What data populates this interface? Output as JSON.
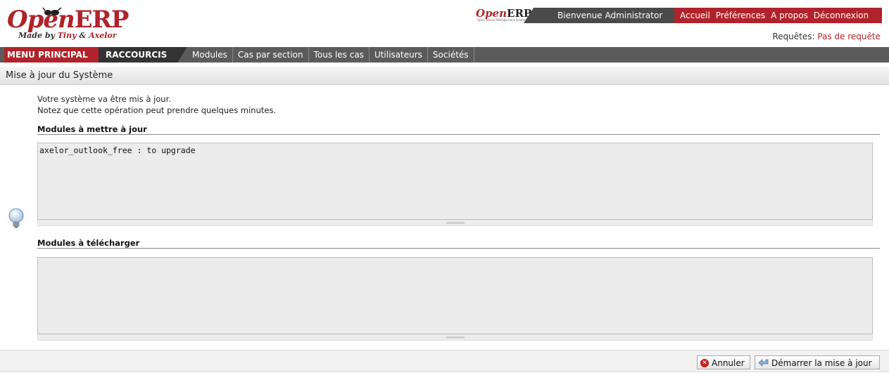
{
  "header": {
    "logo_open": "Open",
    "logo_erp": "ERP",
    "logo_tag_prefix": "Made by ",
    "logo_tag_tiny": "Tiny",
    "logo_tag_amp": " & ",
    "logo_tag_axelor": "Axelor",
    "small_logo_open": "Open",
    "small_logo_erp": "ERP",
    "small_logo_sub": "Open Source Management Solution",
    "welcome": "Bienvenue Administrator",
    "links": [
      "Accueil",
      "Préférences",
      "A propos",
      "Déconnexion"
    ],
    "requests_label": "Requêtes: ",
    "requests_value": "Pas de requête"
  },
  "menu": {
    "main": "MENU PRINCIPAL",
    "shortcuts": "RACCOURCIS",
    "items": [
      "Modules",
      "Cas par section",
      "Tous les cas",
      "Utilisateurs",
      "Sociétés"
    ]
  },
  "page": {
    "title": "Mise à jour du Système",
    "intro_line1": "Votre système va être mis à jour.",
    "intro_line2": "Notez que cette opération peut prendre quelques minutes.",
    "section1_label": "Modules à mettre à jour",
    "section1_value": "axelor_outlook_free : to upgrade",
    "section2_label": "Modules à télécharger",
    "section2_value": ""
  },
  "footer": {
    "cancel_label": "Annuler",
    "start_label": "Démarrer la mise à jour"
  },
  "colors": {
    "brand_red": "#b0232a",
    "menu_dark": "#5b5b5b"
  },
  "icons": {
    "bulb": "lightbulb-icon",
    "cancel": "cancel-icon",
    "upgrade": "upgrade-arrow-icon"
  }
}
